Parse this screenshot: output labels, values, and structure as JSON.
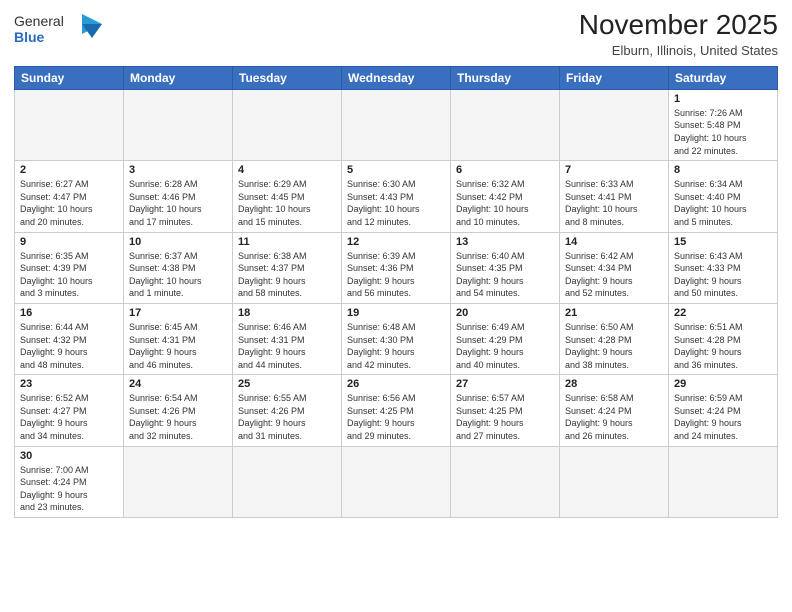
{
  "header": {
    "logo_general": "General",
    "logo_blue": "Blue",
    "month_title": "November 2025",
    "location": "Elburn, Illinois, United States"
  },
  "weekdays": [
    "Sunday",
    "Monday",
    "Tuesday",
    "Wednesday",
    "Thursday",
    "Friday",
    "Saturday"
  ],
  "weeks": [
    [
      {
        "day": "",
        "info": ""
      },
      {
        "day": "",
        "info": ""
      },
      {
        "day": "",
        "info": ""
      },
      {
        "day": "",
        "info": ""
      },
      {
        "day": "",
        "info": ""
      },
      {
        "day": "",
        "info": ""
      },
      {
        "day": "1",
        "info": "Sunrise: 7:26 AM\nSunset: 5:48 PM\nDaylight: 10 hours\nand 22 minutes."
      }
    ],
    [
      {
        "day": "2",
        "info": "Sunrise: 6:27 AM\nSunset: 4:47 PM\nDaylight: 10 hours\nand 20 minutes."
      },
      {
        "day": "3",
        "info": "Sunrise: 6:28 AM\nSunset: 4:46 PM\nDaylight: 10 hours\nand 17 minutes."
      },
      {
        "day": "4",
        "info": "Sunrise: 6:29 AM\nSunset: 4:45 PM\nDaylight: 10 hours\nand 15 minutes."
      },
      {
        "day": "5",
        "info": "Sunrise: 6:30 AM\nSunset: 4:43 PM\nDaylight: 10 hours\nand 12 minutes."
      },
      {
        "day": "6",
        "info": "Sunrise: 6:32 AM\nSunset: 4:42 PM\nDaylight: 10 hours\nand 10 minutes."
      },
      {
        "day": "7",
        "info": "Sunrise: 6:33 AM\nSunset: 4:41 PM\nDaylight: 10 hours\nand 8 minutes."
      },
      {
        "day": "8",
        "info": "Sunrise: 6:34 AM\nSunset: 4:40 PM\nDaylight: 10 hours\nand 5 minutes."
      }
    ],
    [
      {
        "day": "9",
        "info": "Sunrise: 6:35 AM\nSunset: 4:39 PM\nDaylight: 10 hours\nand 3 minutes."
      },
      {
        "day": "10",
        "info": "Sunrise: 6:37 AM\nSunset: 4:38 PM\nDaylight: 10 hours\nand 1 minute."
      },
      {
        "day": "11",
        "info": "Sunrise: 6:38 AM\nSunset: 4:37 PM\nDaylight: 9 hours\nand 58 minutes."
      },
      {
        "day": "12",
        "info": "Sunrise: 6:39 AM\nSunset: 4:36 PM\nDaylight: 9 hours\nand 56 minutes."
      },
      {
        "day": "13",
        "info": "Sunrise: 6:40 AM\nSunset: 4:35 PM\nDaylight: 9 hours\nand 54 minutes."
      },
      {
        "day": "14",
        "info": "Sunrise: 6:42 AM\nSunset: 4:34 PM\nDaylight: 9 hours\nand 52 minutes."
      },
      {
        "day": "15",
        "info": "Sunrise: 6:43 AM\nSunset: 4:33 PM\nDaylight: 9 hours\nand 50 minutes."
      }
    ],
    [
      {
        "day": "16",
        "info": "Sunrise: 6:44 AM\nSunset: 4:32 PM\nDaylight: 9 hours\nand 48 minutes."
      },
      {
        "day": "17",
        "info": "Sunrise: 6:45 AM\nSunset: 4:31 PM\nDaylight: 9 hours\nand 46 minutes."
      },
      {
        "day": "18",
        "info": "Sunrise: 6:46 AM\nSunset: 4:31 PM\nDaylight: 9 hours\nand 44 minutes."
      },
      {
        "day": "19",
        "info": "Sunrise: 6:48 AM\nSunset: 4:30 PM\nDaylight: 9 hours\nand 42 minutes."
      },
      {
        "day": "20",
        "info": "Sunrise: 6:49 AM\nSunset: 4:29 PM\nDaylight: 9 hours\nand 40 minutes."
      },
      {
        "day": "21",
        "info": "Sunrise: 6:50 AM\nSunset: 4:28 PM\nDaylight: 9 hours\nand 38 minutes."
      },
      {
        "day": "22",
        "info": "Sunrise: 6:51 AM\nSunset: 4:28 PM\nDaylight: 9 hours\nand 36 minutes."
      }
    ],
    [
      {
        "day": "23",
        "info": "Sunrise: 6:52 AM\nSunset: 4:27 PM\nDaylight: 9 hours\nand 34 minutes."
      },
      {
        "day": "24",
        "info": "Sunrise: 6:54 AM\nSunset: 4:26 PM\nDaylight: 9 hours\nand 32 minutes."
      },
      {
        "day": "25",
        "info": "Sunrise: 6:55 AM\nSunset: 4:26 PM\nDaylight: 9 hours\nand 31 minutes."
      },
      {
        "day": "26",
        "info": "Sunrise: 6:56 AM\nSunset: 4:25 PM\nDaylight: 9 hours\nand 29 minutes."
      },
      {
        "day": "27",
        "info": "Sunrise: 6:57 AM\nSunset: 4:25 PM\nDaylight: 9 hours\nand 27 minutes."
      },
      {
        "day": "28",
        "info": "Sunrise: 6:58 AM\nSunset: 4:24 PM\nDaylight: 9 hours\nand 26 minutes."
      },
      {
        "day": "29",
        "info": "Sunrise: 6:59 AM\nSunset: 4:24 PM\nDaylight: 9 hours\nand 24 minutes."
      }
    ],
    [
      {
        "day": "30",
        "info": "Sunrise: 7:00 AM\nSunset: 4:24 PM\nDaylight: 9 hours\nand 23 minutes."
      },
      {
        "day": "",
        "info": ""
      },
      {
        "day": "",
        "info": ""
      },
      {
        "day": "",
        "info": ""
      },
      {
        "day": "",
        "info": ""
      },
      {
        "day": "",
        "info": ""
      },
      {
        "day": "",
        "info": ""
      }
    ]
  ]
}
